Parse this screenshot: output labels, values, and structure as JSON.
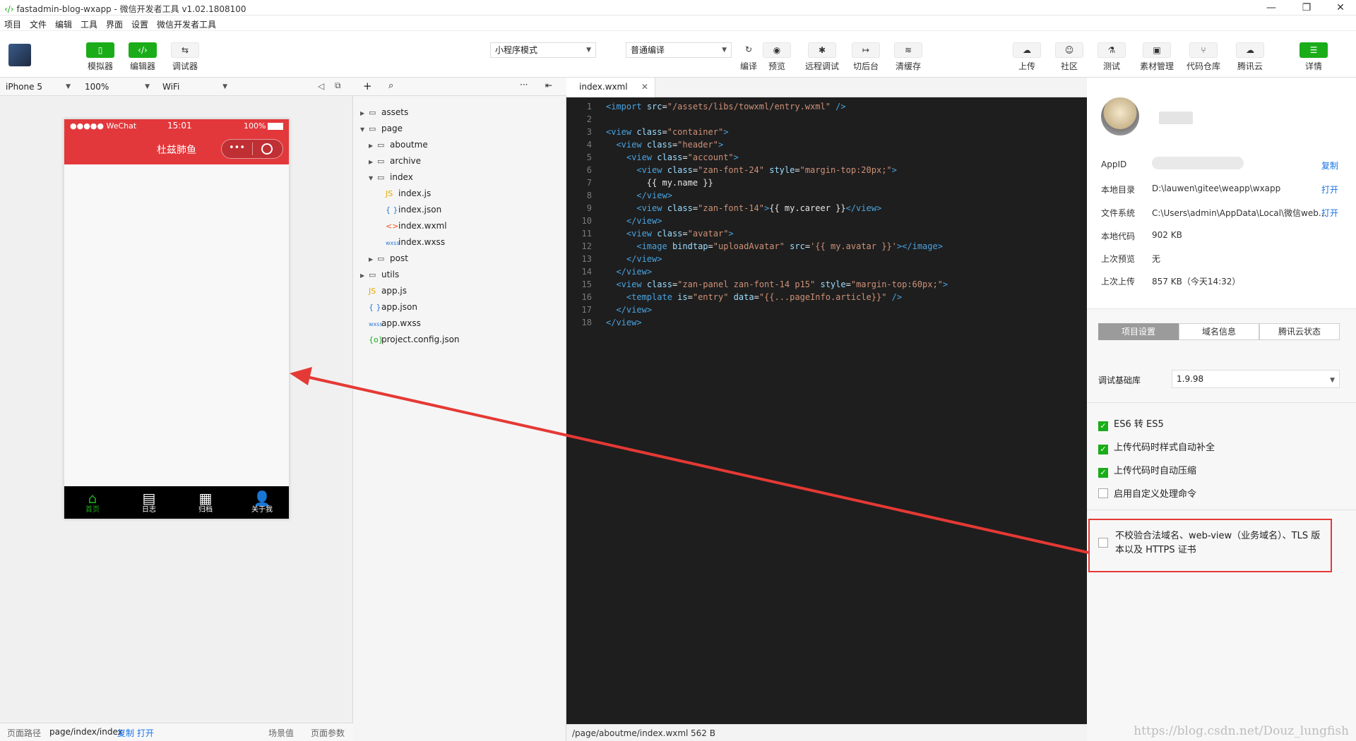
{
  "window": {
    "title": "fastadmin-blog-wxapp - 微信开发者工具 v1.02.1808100",
    "controls": [
      "—",
      "❐",
      "✕"
    ]
  },
  "menu": [
    "项目",
    "文件",
    "编辑",
    "工具",
    "界面",
    "设置",
    "微信开发者工具"
  ],
  "toolbar": {
    "left": [
      {
        "label": "模拟器",
        "icon": "phone-icon",
        "glyph": "▯"
      },
      {
        "label": "编辑器",
        "icon": "code-icon",
        "glyph": "‹/›"
      },
      {
        "label": "调试器",
        "icon": "debug-icon",
        "glyph": "⇆"
      }
    ],
    "mode_select": "小程序模式",
    "compile_select": "普通编译",
    "mid": [
      {
        "label": "编译",
        "icon": "refresh-icon",
        "glyph": "↻"
      },
      {
        "label": "预览",
        "icon": "eye-icon",
        "glyph": "◉"
      },
      {
        "label": "远程调试",
        "icon": "bug-icon",
        "glyph": "✱"
      },
      {
        "label": "切后台",
        "icon": "switch-icon",
        "glyph": "↦"
      },
      {
        "label": "清缓存",
        "icon": "layers-icon",
        "glyph": "≋"
      }
    ],
    "right": [
      {
        "label": "上传",
        "icon": "upload-cloud-icon",
        "glyph": "☁"
      },
      {
        "label": "社区",
        "icon": "community-icon",
        "glyph": "☺"
      },
      {
        "label": "测试",
        "icon": "flask-icon",
        "glyph": "⚗"
      },
      {
        "label": "素材管理",
        "icon": "material-icon",
        "glyph": "▣"
      },
      {
        "label": "代码仓库",
        "icon": "branch-icon",
        "glyph": "⑂"
      },
      {
        "label": "腾讯云",
        "icon": "cloud-icon",
        "glyph": "☁"
      }
    ],
    "details": {
      "label": "详情",
      "icon": "menu-icon",
      "glyph": "☰"
    }
  },
  "device_bar": {
    "device": "iPhone 5",
    "zoom": "100%",
    "network": "WiFi"
  },
  "phone": {
    "status": {
      "carrier": "●●●●● WeChat",
      "time": "15:01",
      "battery": "100%"
    },
    "nav_title": "杜兹肺鱼",
    "tabs": [
      {
        "label": "首页",
        "glyph": "⌂",
        "icon": "home-icon"
      },
      {
        "label": "日志",
        "glyph": "▤",
        "icon": "journal-icon"
      },
      {
        "label": "归档",
        "glyph": "▦",
        "icon": "archive-icon"
      },
      {
        "label": "关于我",
        "glyph": "👤",
        "icon": "person-icon"
      }
    ]
  },
  "sim_footer": {
    "path_label": "页面路径",
    "path": "page/index/index",
    "copy": "复制",
    "open": "打开",
    "scene": "场景值",
    "params": "页面参数"
  },
  "filetree": [
    {
      "name": "assets",
      "type": "folder",
      "level": 0,
      "open": false
    },
    {
      "name": "page",
      "type": "folder",
      "level": 0,
      "open": true
    },
    {
      "name": "aboutme",
      "type": "folder",
      "level": 1,
      "open": false
    },
    {
      "name": "archive",
      "type": "folder",
      "level": 1,
      "open": false
    },
    {
      "name": "index",
      "type": "folder",
      "level": 1,
      "open": true
    },
    {
      "name": "index.js",
      "type": "js",
      "level": 2
    },
    {
      "name": "index.json",
      "type": "json",
      "level": 2
    },
    {
      "name": "index.wxml",
      "type": "wxml",
      "level": 2
    },
    {
      "name": "index.wxss",
      "type": "wxss",
      "level": 2
    },
    {
      "name": "post",
      "type": "folder",
      "level": 1,
      "open": false
    },
    {
      "name": "utils",
      "type": "folder",
      "level": 0,
      "open": false
    },
    {
      "name": "app.js",
      "type": "js",
      "level": 0
    },
    {
      "name": "app.json",
      "type": "json",
      "level": 0
    },
    {
      "name": "app.wxss",
      "type": "wxss",
      "level": 0
    },
    {
      "name": "project.config.json",
      "type": "config",
      "level": 0
    }
  ],
  "editor": {
    "tab": "index.wxml",
    "footer_path": "/page/aboutme/index.wxml",
    "footer_size": "562 B",
    "lines": [
      "<import src=\"/assets/libs/towxml/entry.wxml\" />",
      "",
      "<view class=\"container\">",
      "  <view class=\"header\">",
      "    <view class=\"account\">",
      "      <view class=\"zan-font-24\" style=\"margin-top:20px;\">",
      "        {{ my.name }}",
      "      </view>",
      "      <view class=\"zan-font-14\">{{ my.career }}</view>",
      "    </view>",
      "    <view class=\"avatar\">",
      "      <image bindtap=\"uploadAvatar\" src='{{ my.avatar }}'></image>",
      "    </view>",
      "  </view>",
      "  <view class=\"zan-panel zan-font-14 p15\" style=\"margin-top:60px;\">",
      "    <template is=\"entry\" data=\"{{...pageInfo.article}}\" />",
      "  </view>",
      "</view>"
    ]
  },
  "details": {
    "appid_label": "AppID",
    "copy": "复制",
    "open": "打开",
    "rows": [
      {
        "label": "本地目录",
        "value": "D:\\lauwen\\gitee\\weapp\\wxapp"
      },
      {
        "label": "文件系统",
        "value": "C:\\Users\\admin\\AppData\\Local\\微信web..."
      },
      {
        "label": "本地代码",
        "value": "902 KB"
      },
      {
        "label": "上次预览",
        "value": "无"
      },
      {
        "label": "上次上传",
        "value": "857 KB（今天14:32）"
      }
    ],
    "segments": [
      "项目设置",
      "域名信息",
      "腾讯云状态"
    ],
    "lib_label": "调试基础库",
    "lib_value": "1.9.98",
    "checks": [
      {
        "label": "ES6 转 ES5",
        "on": true
      },
      {
        "label": "上传代码时样式自动补全",
        "on": true
      },
      {
        "label": "上传代码时自动压缩",
        "on": true
      },
      {
        "label": "启用自定义处理命令",
        "on": false
      }
    ],
    "domain_check_line1": "不校验合法域名、web-view（业务域名）、TLS 版",
    "domain_check_line2": "本以及 HTTPS 证书"
  },
  "watermark": "https://blog.csdn.net/Douz_lungfish",
  "colors": {
    "accent": "#1aad19",
    "nav_red": "#e2383c",
    "annotation_red": "#e53935"
  }
}
